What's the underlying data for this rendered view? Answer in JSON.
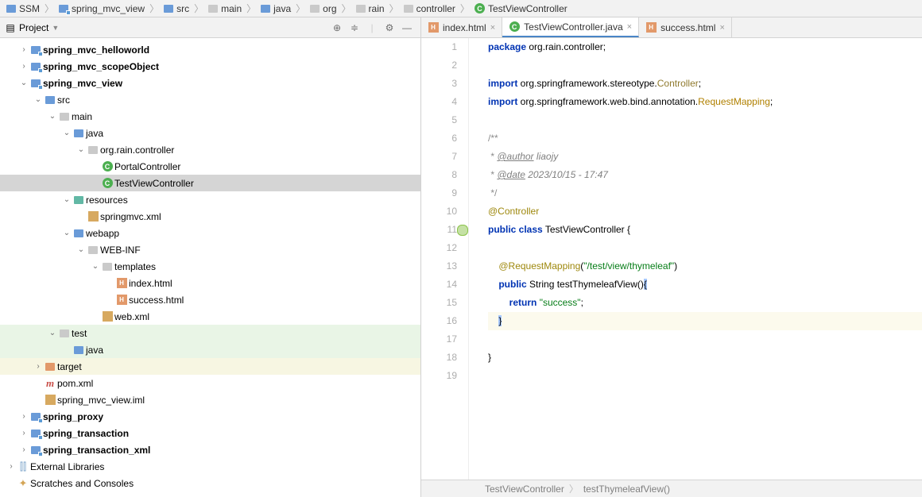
{
  "breadcrumb": [
    {
      "label": "SSM",
      "icon": "folder-blue"
    },
    {
      "label": "spring_mvc_view",
      "icon": "module",
      "bold": true
    },
    {
      "label": "src",
      "icon": "folder-blue"
    },
    {
      "label": "main",
      "icon": "folder-grey"
    },
    {
      "label": "java",
      "icon": "folder-blue"
    },
    {
      "label": "org",
      "icon": "folder-grey"
    },
    {
      "label": "rain",
      "icon": "folder-grey"
    },
    {
      "label": "controller",
      "icon": "folder-grey"
    },
    {
      "label": "TestViewController",
      "icon": "class"
    }
  ],
  "sidebar": {
    "title": "Project",
    "toolbar": [
      "locate",
      "collapse",
      "divider",
      "settings",
      "hide"
    ]
  },
  "tree": [
    {
      "ind": 1,
      "arrow": ">",
      "icon": "module",
      "label": "spring_mvc_helloworld",
      "bold": true
    },
    {
      "ind": 1,
      "arrow": ">",
      "icon": "module",
      "label": "spring_mvc_scopeObject",
      "bold": true
    },
    {
      "ind": 1,
      "arrow": "v",
      "icon": "module",
      "label": "spring_mvc_view",
      "bold": true
    },
    {
      "ind": 2,
      "arrow": "v",
      "icon": "folder-blue",
      "label": "src"
    },
    {
      "ind": 3,
      "arrow": "v",
      "icon": "folder-grey",
      "label": "main"
    },
    {
      "ind": 4,
      "arrow": "v",
      "icon": "folder-blue",
      "label": "java"
    },
    {
      "ind": 5,
      "arrow": "v",
      "icon": "folder-grey",
      "label": "org.rain.controller"
    },
    {
      "ind": 6,
      "arrow": "",
      "icon": "class",
      "label": "PortalController"
    },
    {
      "ind": 6,
      "arrow": "",
      "icon": "class",
      "label": "TestViewController",
      "selected": true
    },
    {
      "ind": 4,
      "arrow": "v",
      "icon": "folder-teal",
      "label": "resources"
    },
    {
      "ind": 5,
      "arrow": "",
      "icon": "xml",
      "label": "springmvc.xml"
    },
    {
      "ind": 4,
      "arrow": "v",
      "icon": "folder-blue",
      "label": "webapp"
    },
    {
      "ind": 5,
      "arrow": "v",
      "icon": "folder-grey",
      "label": "WEB-INF"
    },
    {
      "ind": 6,
      "arrow": "v",
      "icon": "folder-grey",
      "label": "templates"
    },
    {
      "ind": 7,
      "arrow": "",
      "icon": "html",
      "label": "index.html"
    },
    {
      "ind": 7,
      "arrow": "",
      "icon": "html",
      "label": "success.html"
    },
    {
      "ind": 6,
      "arrow": "",
      "icon": "xml",
      "label": "web.xml"
    },
    {
      "ind": 3,
      "arrow": "v",
      "icon": "folder-grey",
      "label": "test",
      "hl": "green"
    },
    {
      "ind": 4,
      "arrow": "",
      "icon": "folder-blue",
      "label": "java",
      "hl": "green"
    },
    {
      "ind": 2,
      "arrow": ">",
      "icon": "folder-orange",
      "label": "target",
      "hl": "yellow"
    },
    {
      "ind": 2,
      "arrow": "",
      "icon": "maven",
      "label": "pom.xml"
    },
    {
      "ind": 2,
      "arrow": "",
      "icon": "xml",
      "label": "spring_mvc_view.iml"
    },
    {
      "ind": 1,
      "arrow": ">",
      "icon": "module",
      "label": "spring_proxy",
      "bold": true
    },
    {
      "ind": 1,
      "arrow": ">",
      "icon": "module",
      "label": "spring_transaction",
      "bold": true
    },
    {
      "ind": 1,
      "arrow": ">",
      "icon": "module",
      "label": "spring_transaction_xml",
      "bold": true
    },
    {
      "ind": 0,
      "arrow": ">",
      "icon": "lib",
      "label": "External Libraries"
    },
    {
      "ind": 0,
      "arrow": "",
      "icon": "scratch",
      "label": "Scratches and Consoles"
    }
  ],
  "tabs": [
    {
      "label": "index.html",
      "icon": "html",
      "active": false
    },
    {
      "label": "TestViewController.java",
      "icon": "class",
      "active": true
    },
    {
      "label": "success.html",
      "icon": "html",
      "active": false
    }
  ],
  "code": {
    "lines": [
      {
        "n": 1,
        "t": "package",
        "segs": [
          [
            "kw",
            "package"
          ],
          [
            "",
            " org.rain.controller;"
          ]
        ]
      },
      {
        "n": 2,
        "t": ""
      },
      {
        "n": 3,
        "segs": [
          [
            "kw",
            "import"
          ],
          [
            "",
            " org.springframework.stereotype."
          ],
          [
            "ctl",
            "Controller"
          ],
          [
            "",
            ";"
          ]
        ]
      },
      {
        "n": 4,
        "segs": [
          [
            "kw",
            "import"
          ],
          [
            "",
            " org.springframework.web.bind.annotation."
          ],
          [
            "req",
            "RequestMapping"
          ],
          [
            "",
            ";"
          ]
        ]
      },
      {
        "n": 5,
        "t": ""
      },
      {
        "n": 6,
        "segs": [
          [
            "cm",
            "/**"
          ]
        ]
      },
      {
        "n": 7,
        "segs": [
          [
            "cm",
            " * "
          ],
          [
            "tag-u",
            "@author"
          ],
          [
            "ann-it",
            " liaojy"
          ]
        ]
      },
      {
        "n": 8,
        "segs": [
          [
            "cm",
            " * "
          ],
          [
            "tag-u",
            "@date"
          ],
          [
            "ann-it",
            " 2023/10/15 - 17:47"
          ]
        ]
      },
      {
        "n": 9,
        "segs": [
          [
            "cm",
            " */"
          ]
        ]
      },
      {
        "n": 10,
        "segs": [
          [
            "ann",
            "@Controller"
          ]
        ]
      },
      {
        "n": 11,
        "marker": true,
        "segs": [
          [
            "kw",
            "public class"
          ],
          [
            "",
            " "
          ],
          [
            "cls",
            "TestViewController"
          ],
          [
            "",
            " {"
          ]
        ]
      },
      {
        "n": 12,
        "t": ""
      },
      {
        "n": 13,
        "segs": [
          [
            "",
            "    "
          ],
          [
            "ann",
            "@RequestMapping"
          ],
          [
            "",
            "("
          ],
          [
            "str",
            "\"/test/view/thymeleaf\""
          ],
          [
            "",
            ")"
          ]
        ]
      },
      {
        "n": 14,
        "segs": [
          [
            "",
            "    "
          ],
          [
            "kw",
            "public"
          ],
          [
            "",
            " String testThymeleafView()"
          ],
          [
            "caret",
            "{"
          ]
        ]
      },
      {
        "n": 15,
        "segs": [
          [
            "",
            "        "
          ],
          [
            "kw",
            "return"
          ],
          [
            "",
            " "
          ],
          [
            "str",
            "\"success\""
          ],
          [
            "",
            ";"
          ]
        ]
      },
      {
        "n": 16,
        "hl": true,
        "segs": [
          [
            "",
            "    "
          ],
          [
            "caret",
            "}"
          ]
        ]
      },
      {
        "n": 17,
        "t": ""
      },
      {
        "n": 18,
        "segs": [
          [
            "",
            "}"
          ]
        ]
      },
      {
        "n": 19,
        "t": ""
      }
    ]
  },
  "status": {
    "class": "TestViewController",
    "method": "testThymeleafView()"
  }
}
